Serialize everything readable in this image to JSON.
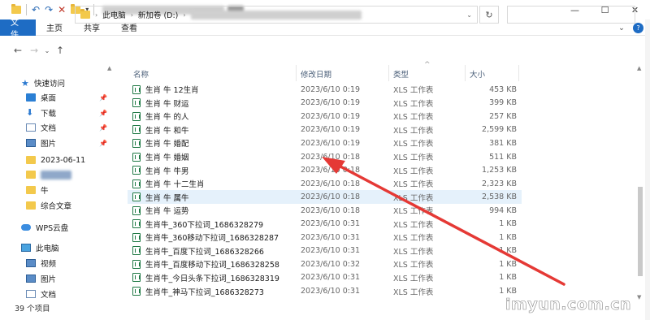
{
  "window": {
    "controls": {
      "minimize": "—",
      "maximize": "☐",
      "close": "✕"
    }
  },
  "ribbon": {
    "tabs": [
      "文件",
      "主页",
      "共享",
      "查看"
    ],
    "help": "?"
  },
  "address": {
    "crumbs": [
      "此电脑",
      "新加卷 (D:)"
    ]
  },
  "sidebar": {
    "items": [
      {
        "label": "快速访问",
        "icon": "star-icon"
      },
      {
        "label": "桌面",
        "icon": "desktop-icon",
        "pinned": true
      },
      {
        "label": "下载",
        "icon": "download-icon",
        "pinned": true
      },
      {
        "label": "文档",
        "icon": "document-icon",
        "pinned": true
      },
      {
        "label": "图片",
        "icon": "pictures-icon",
        "pinned": true
      },
      {
        "label": "2023-06-11",
        "icon": "folder-icon"
      },
      {
        "label": "",
        "icon": "folder-icon"
      },
      {
        "label": "牛",
        "icon": "folder-icon"
      },
      {
        "label": "综合文章",
        "icon": "folder-icon"
      },
      {
        "label": "WPS云盘",
        "icon": "cloud-icon"
      },
      {
        "label": "此电脑",
        "icon": "computer-icon"
      },
      {
        "label": "视频",
        "icon": "video-icon"
      },
      {
        "label": "图片",
        "icon": "pictures-icon"
      },
      {
        "label": "文档",
        "icon": "document-icon"
      }
    ]
  },
  "list": {
    "headers": {
      "name": "名称",
      "date": "修改日期",
      "type": "类型",
      "size": "大小"
    },
    "files": [
      {
        "name": "生肖 牛 12生肖",
        "date": "2023/6/10 0:19",
        "type": "XLS 工作表",
        "size": "453 KB"
      },
      {
        "name": "生肖 牛 财运",
        "date": "2023/6/10 0:19",
        "type": "XLS 工作表",
        "size": "399 KB"
      },
      {
        "name": "生肖 牛 的人",
        "date": "2023/6/10 0:19",
        "type": "XLS 工作表",
        "size": "257 KB"
      },
      {
        "name": "生肖 牛 和牛",
        "date": "2023/6/10 0:19",
        "type": "XLS 工作表",
        "size": "2,599 KB"
      },
      {
        "name": "生肖 牛 婚配",
        "date": "2023/6/10 0:19",
        "type": "XLS 工作表",
        "size": "381 KB"
      },
      {
        "name": "生肖 牛 婚姻",
        "date": "2023/6/10 0:18",
        "type": "XLS 工作表",
        "size": "511 KB"
      },
      {
        "name": "生肖 牛 牛男",
        "date": "2023/6/10 0:18",
        "type": "XLS 工作表",
        "size": "1,253 KB"
      },
      {
        "name": "生肖 牛 十二生肖",
        "date": "2023/6/10 0:18",
        "type": "XLS 工作表",
        "size": "2,323 KB"
      },
      {
        "name": "生肖 牛 属牛",
        "date": "2023/6/10 0:18",
        "type": "XLS 工作表",
        "size": "2,538 KB",
        "selected": true
      },
      {
        "name": "生肖 牛 运势",
        "date": "2023/6/10 0:18",
        "type": "XLS 工作表",
        "size": "994 KB"
      },
      {
        "name": "生肖牛_360下拉词_1686328279",
        "date": "2023/6/10 0:31",
        "type": "XLS 工作表",
        "size": "1 KB"
      },
      {
        "name": "生肖牛_360移动下拉词_1686328287",
        "date": "2023/6/10 0:31",
        "type": "XLS 工作表",
        "size": "1 KB"
      },
      {
        "name": "生肖牛_百度下拉词_1686328266",
        "date": "2023/6/10 0:31",
        "type": "XLS 工作表",
        "size": "1 KB"
      },
      {
        "name": "生肖牛_百度移动下拉词_1686328258",
        "date": "2023/6/10 0:32",
        "type": "XLS 工作表",
        "size": "1 KB"
      },
      {
        "name": "生肖牛_今日头条下拉词_1686328319",
        "date": "2023/6/10 0:31",
        "type": "XLS 工作表",
        "size": "1 KB"
      },
      {
        "name": "生肖牛_神马下拉词_1686328273",
        "date": "2023/6/10 0:31",
        "type": "XLS 工作表",
        "size": "1 KB"
      }
    ]
  },
  "status": "39 个项目",
  "watermark": "imyun.com.cn",
  "colors": {
    "accent": "#1e6cc4",
    "selected_row": "#e5f1fb",
    "annotation_arrow": "#e53935"
  }
}
